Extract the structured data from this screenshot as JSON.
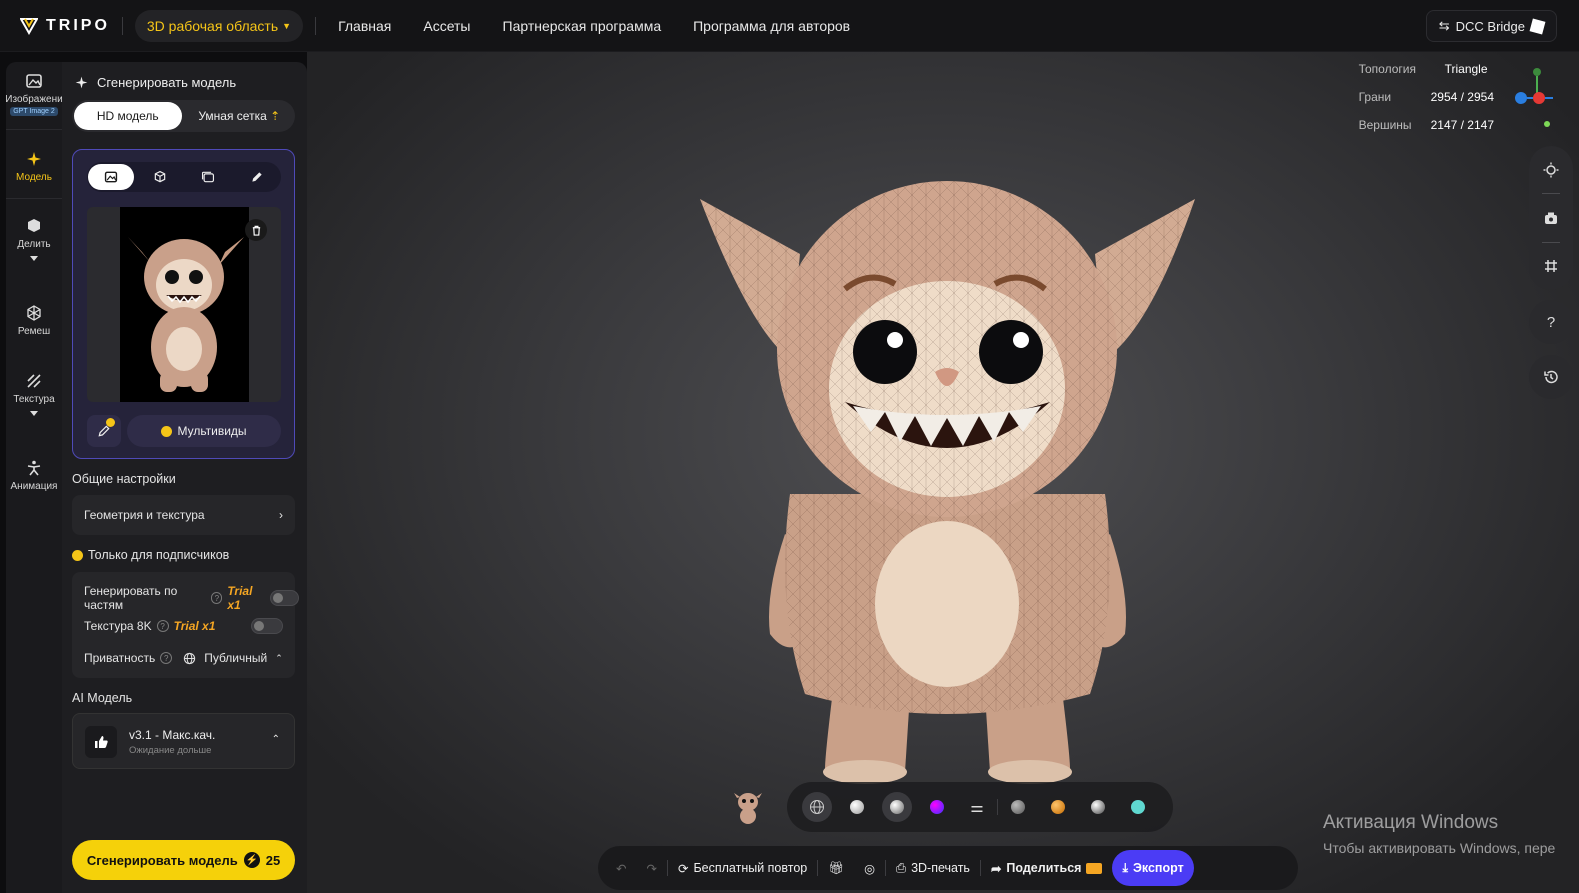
{
  "app": {
    "logo": "TRIPO",
    "workspace": "3D рабочая область",
    "dcc_bridge": "DCC Bridge"
  },
  "nav": [
    "Главная",
    "Ассеты",
    "Партнерская программа",
    "Программа для авторов"
  ],
  "rail": {
    "images": "Изображени",
    "images_badge": "GPT Image 2",
    "model": "Модель",
    "split": "Делить",
    "remesh": "Ремеш",
    "texture": "Текстура",
    "animation": "Анимация"
  },
  "panel": {
    "title": "Сгенерировать модель",
    "mode_hd": "HD модель",
    "mode_smart": "Умная сетка",
    "multiview": "Мультивиды",
    "general_settings": "Общие настройки",
    "geometry_texture": "Геометрия и текстура",
    "subscribers_only": "Только для подписчиков",
    "gen_parts": "Генерировать по частям",
    "gen_parts_trial": "Trial x1",
    "texture_8k": "Текстура 8K",
    "texture_8k_trial": "Trial x1",
    "privacy": "Приватность",
    "privacy_value": "Публичный",
    "ai_model_label": "AI Модель",
    "ai_model_name": "v3.1 - Макс.кач.",
    "ai_model_sub": "Ожидание дольше",
    "generate_btn": "Сгенерировать модель",
    "generate_cost": "25"
  },
  "stats": {
    "topology_k": "Топология",
    "topology_v": "Triangle",
    "faces_k": "Грани",
    "faces_v": "2954 / 2954",
    "verts_k": "Вершины",
    "verts_v": "2147 / 2147"
  },
  "bottom": {
    "free_retry": "Бесплатный повтор",
    "print3d": "3D-печать",
    "share": "Поделиться",
    "export": "Экспорт"
  },
  "watermark": {
    "line1": "Активация Windows",
    "line2": "Чтобы активировать Windows, пере"
  },
  "colors": {
    "accent": "#f5c518",
    "export": "#4b3cf5",
    "selection_border": "#4f4ab8"
  }
}
